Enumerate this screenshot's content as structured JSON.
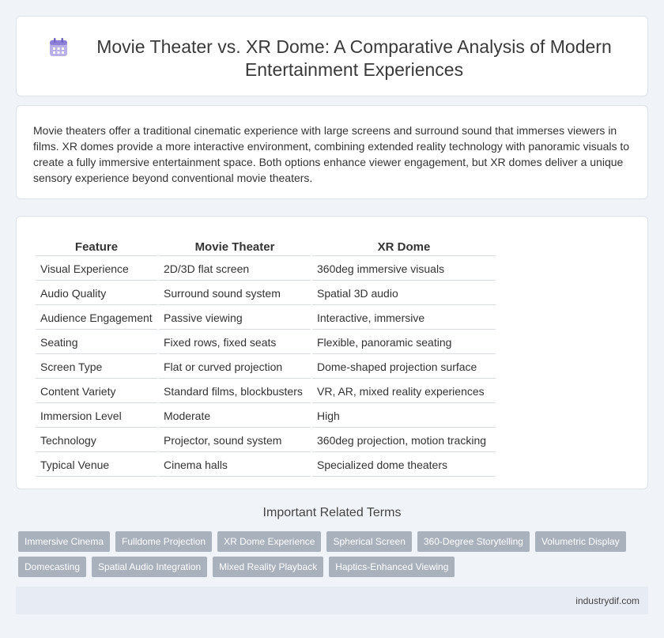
{
  "header": {
    "title": "Movie Theater vs. XR Dome: A Comparative Analysis of Modern Entertainment Experiences",
    "icon": "calendar-icon",
    "icon_color": "#8b7fd6"
  },
  "intro": {
    "text": "Movie theaters offer a traditional cinematic experience with large screens and surround sound that immerses viewers in films. XR domes provide a more interactive environment, combining extended reality technology with panoramic visuals to create a fully immersive entertainment space. Both options enhance viewer engagement, but XR domes deliver a unique sensory experience beyond conventional movie theaters."
  },
  "table": {
    "headers": [
      "Feature",
      "Movie Theater",
      "XR Dome"
    ],
    "rows": [
      [
        "Visual Experience",
        "2D/3D flat screen",
        "360deg immersive visuals"
      ],
      [
        "Audio Quality",
        "Surround sound system",
        "Spatial 3D audio"
      ],
      [
        "Audience Engagement",
        "Passive viewing",
        "Interactive, immersive"
      ],
      [
        "Seating",
        "Fixed rows, fixed seats",
        "Flexible, panoramic seating"
      ],
      [
        "Screen Type",
        "Flat or curved projection",
        "Dome-shaped projection surface"
      ],
      [
        "Content Variety",
        "Standard films, blockbusters",
        "VR, AR, mixed reality experiences"
      ],
      [
        "Immersion Level",
        "Moderate",
        "High"
      ],
      [
        "Technology",
        "Projector, sound system",
        "360deg projection, motion tracking"
      ],
      [
        "Typical Venue",
        "Cinema halls",
        "Specialized dome theaters"
      ]
    ]
  },
  "related": {
    "title": "Important Related Terms",
    "tags": [
      "Immersive Cinema",
      "Fulldome Projection",
      "XR Dome Experience",
      "Spherical Screen",
      "360-Degree Storytelling",
      "Volumetric Display",
      "Domecasting",
      "Spatial Audio Integration",
      "Mixed Reality Playback",
      "Haptics-Enhanced Viewing"
    ],
    "tag_color": "#a9b1bd"
  },
  "footer": {
    "site": "industrydif.com"
  }
}
